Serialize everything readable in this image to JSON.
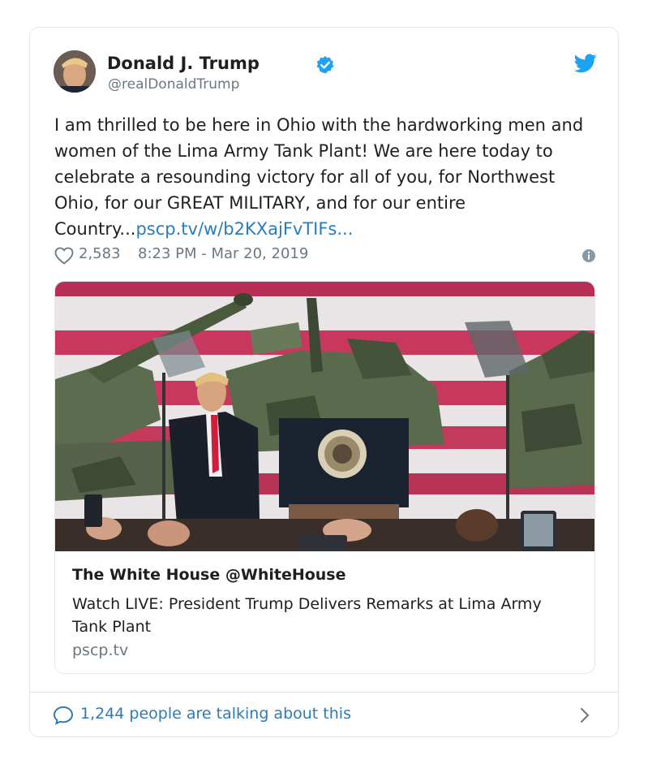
{
  "tweet": {
    "author_name": "Donald J. Trump",
    "handle": "@realDonaldTrump",
    "text": "I am thrilled to be here in Ohio with the hardworking men and women of the Lima Army Tank Plant! We are here today to celebrate a resounding victory for all of you, for Northwest Ohio, for our GREAT MILITARY, and for our entire Country...",
    "link": "pscp.tv/w/b2KXajFvTIFs...",
    "likes": "2,583",
    "timestamp": "8:23 PM - Mar 20, 2019"
  },
  "embed": {
    "author": "The White House @WhiteHouse",
    "title": "Watch LIVE: President Trump Delivers Remarks at Lima Army Tank Plant",
    "domain": "pscp.tv"
  },
  "footer": {
    "talking": "1,244 people are talking about this"
  },
  "icons": {
    "verified": "verified-badge-icon",
    "bird": "twitter-bird-icon",
    "heart": "heart-icon",
    "info": "info-icon",
    "bubble": "speech-bubble-icon",
    "chevron": "chevron-right-icon"
  },
  "colors": {
    "brand_blue": "#1da1f2",
    "link_blue": "#2b7bb9",
    "muted_gray": "#697882",
    "border": "#e1e8ed"
  }
}
